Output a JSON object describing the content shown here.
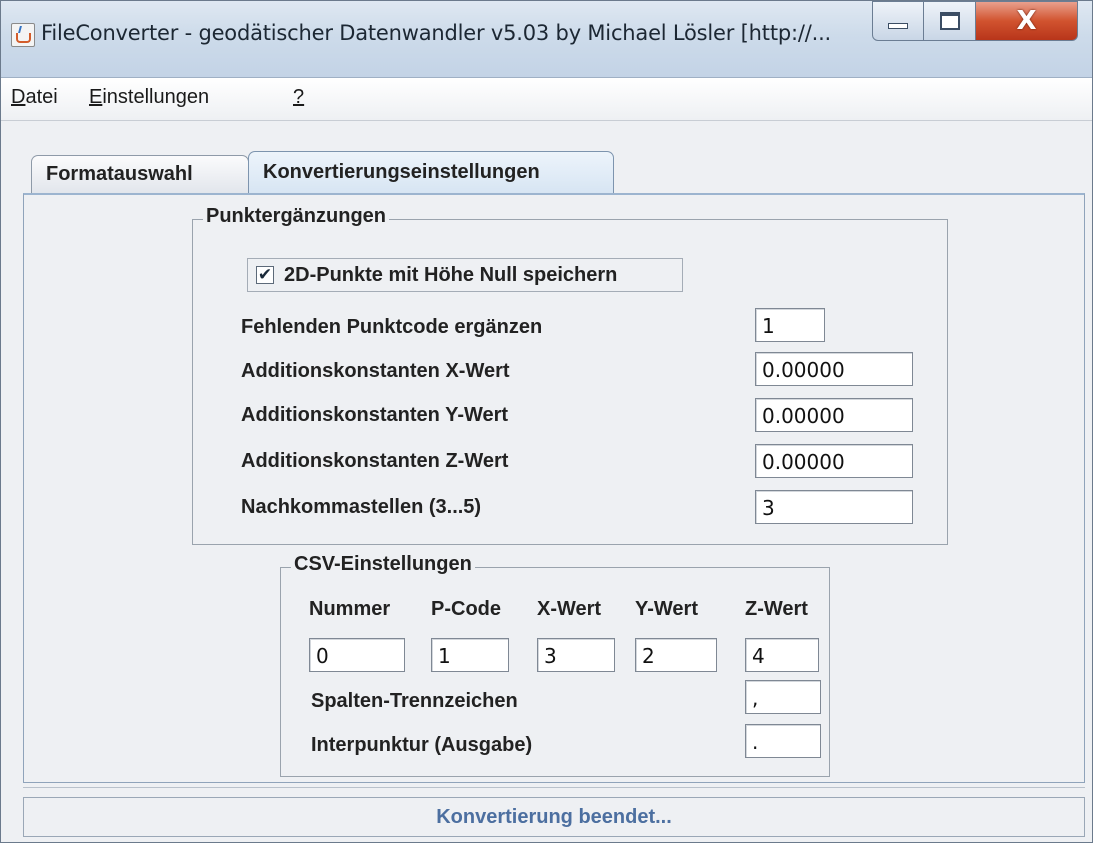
{
  "window": {
    "title": "FileConverter - geodätischer Datenwandler v5.03 by Michael Lösler [http://...",
    "controls": {
      "minimize": "minimize",
      "maximize": "maximize",
      "close": "X"
    }
  },
  "menu": [
    {
      "label": "Datei"
    },
    {
      "label": "Einstellungen"
    },
    {
      "label": "?"
    }
  ],
  "tabs": [
    {
      "label": "Formatauswahl",
      "active": false
    },
    {
      "label": "Konvertierungseinstellungen",
      "active": true
    }
  ],
  "punktergaenzungen": {
    "title": "Punktergänzungen",
    "checkbox_label": "2D-Punkte mit Höhe Null speichern",
    "checkbox_checked": true,
    "rows": [
      {
        "label": "Fehlenden Punktcode ergänzen",
        "value": "1"
      },
      {
        "label": "Additionskonstanten X-Wert",
        "value": "0.00000"
      },
      {
        "label": "Additionskonstanten Y-Wert",
        "value": "0.00000"
      },
      {
        "label": "Additionskonstanten Z-Wert",
        "value": "0.00000"
      },
      {
        "label": "Nachkommastellen (3...5)",
        "value": "3"
      }
    ]
  },
  "csv": {
    "title": "CSV-Einstellungen",
    "columns": [
      {
        "header": "Nummer",
        "value": "0"
      },
      {
        "header": "P-Code",
        "value": "1"
      },
      {
        "header": "X-Wert",
        "value": "3"
      },
      {
        "header": "Y-Wert",
        "value": "2"
      },
      {
        "header": "Z-Wert",
        "value": "4"
      }
    ],
    "separator_label": "Spalten-Trennzeichen",
    "separator_value": ",",
    "decimal_label": "Interpunktur (Ausgabe)",
    "decimal_value": "."
  },
  "status": "Konvertierung beendet..."
}
